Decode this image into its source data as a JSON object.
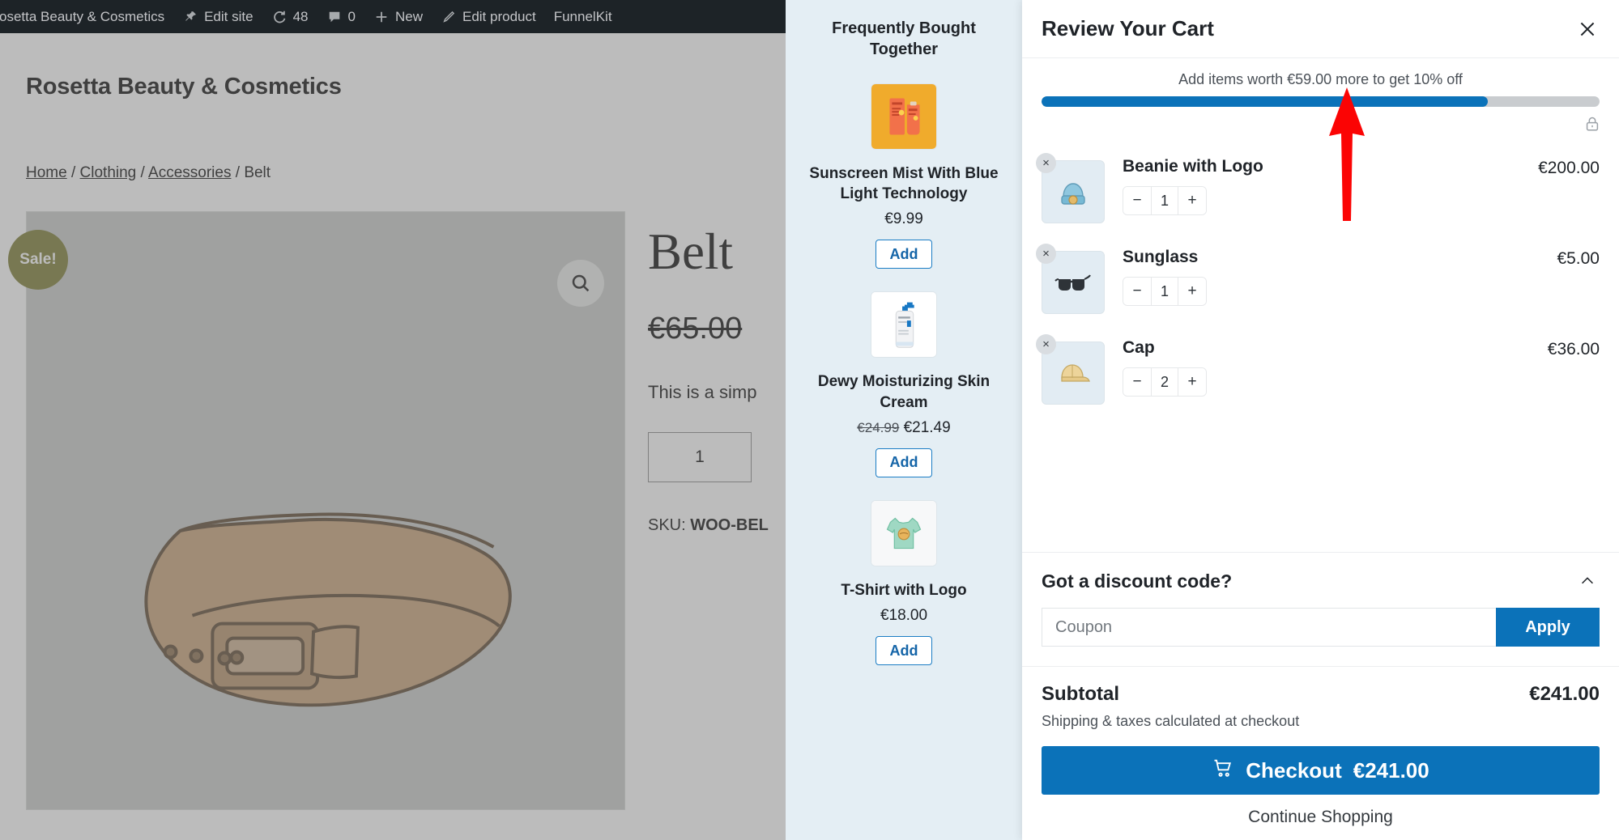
{
  "adminbar": {
    "site_name": "osetta Beauty & Cosmetics",
    "items": [
      {
        "label": "Edit site",
        "icon": "pin-icon"
      },
      {
        "label": "48",
        "icon": "updates-icon"
      },
      {
        "label": "0",
        "icon": "comment-icon"
      },
      {
        "label": "New",
        "icon": "plus-icon"
      },
      {
        "label": "Edit product",
        "icon": "pencil-icon"
      },
      {
        "label": "FunnelKit",
        "icon": ""
      }
    ]
  },
  "page": {
    "site_title": "Rosetta Beauty & Cosmetics",
    "breadcrumb": [
      {
        "label": "Home",
        "link": true
      },
      {
        "label": "Clothing",
        "link": true
      },
      {
        "label": "Accessories",
        "link": true
      },
      {
        "label": "Belt",
        "link": false
      }
    ],
    "breadcrumb_separator": "/",
    "sale_badge": "Sale!",
    "zoom_icon": "search-icon",
    "product": {
      "title": "Belt",
      "price": "€65.00",
      "description": "This is a simp",
      "quantity": "1",
      "sku_label": "SKU:",
      "sku_value": "WOO-BEL"
    }
  },
  "fbt": {
    "title": "Frequently Bought Together",
    "items": [
      {
        "name": "Sunscreen Mist With Blue Light Technology",
        "price": "€9.99",
        "old_price": "",
        "add_label": "Add",
        "thumb": "sunscreen-tubes-image"
      },
      {
        "name": "Dewy Moisturizing Skin Cream",
        "price": "€21.49",
        "old_price": "€24.99",
        "add_label": "Add",
        "thumb": "lotion-pump-bottle-image"
      },
      {
        "name": "T-Shirt with Logo",
        "price": "€18.00",
        "old_price": "",
        "add_label": "Add",
        "thumb": "tshirt-image"
      }
    ]
  },
  "cart": {
    "title": "Review Your Cart",
    "close_icon": "close-icon",
    "lock_icon": "lock-icon",
    "progress": {
      "message": "Add items worth €59.00 more to get 10% off",
      "percent": 80,
      "fill_color": "#0b72b9",
      "track_color": "#c9cccf"
    },
    "items": [
      {
        "name": "Beanie with Logo",
        "price": "€200.00",
        "quantity": "1",
        "thumb": "beanie-image",
        "decrease_label": "−",
        "increase_label": "+",
        "remove_label": "×"
      },
      {
        "name": "Sunglass",
        "price": "€5.00",
        "quantity": "1",
        "thumb": "sunglasses-image",
        "decrease_label": "−",
        "increase_label": "+",
        "remove_label": "×"
      },
      {
        "name": "Cap",
        "price": "€36.00",
        "quantity": "2",
        "thumb": "cap-image",
        "decrease_label": "−",
        "increase_label": "+",
        "remove_label": "×"
      }
    ],
    "coupon": {
      "heading": "Got a discount code?",
      "placeholder": "Coupon",
      "value": "",
      "apply_label": "Apply",
      "collapse_icon": "chevron-up-icon"
    },
    "footer": {
      "subtotal_label": "Subtotal",
      "subtotal_value": "€241.00",
      "shipping_note": "Shipping & taxes calculated at checkout",
      "checkout_label": "Checkout",
      "checkout_amount": "€241.00",
      "checkout_icon": "cart-icon",
      "continue_label": "Continue Shopping"
    }
  },
  "annotation": {
    "arrow_color": "#fb0404",
    "arrow_direction": "up"
  }
}
